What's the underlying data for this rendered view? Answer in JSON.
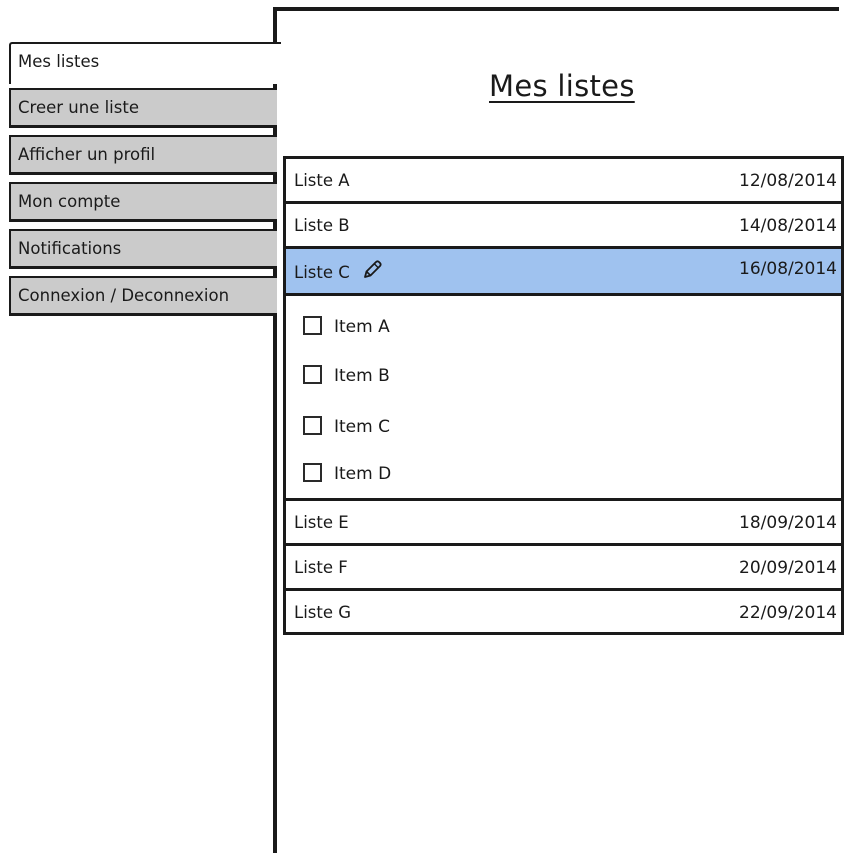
{
  "sidebar": {
    "tabs": [
      {
        "label": "Mes listes",
        "active": true
      },
      {
        "label": "Creer une liste",
        "active": false
      },
      {
        "label": "Afficher un profil",
        "active": false
      },
      {
        "label": "Mon compte",
        "active": false
      },
      {
        "label": "Notifications",
        "active": false
      },
      {
        "label": "Connexion / Deconnexion",
        "active": false
      }
    ]
  },
  "main": {
    "title": "Mes listes",
    "lists": [
      {
        "name": "Liste A",
        "date": "12/08/2014"
      },
      {
        "name": "Liste B",
        "date": "14/08/2014"
      },
      {
        "name": "Liste C",
        "date": "16/08/2014",
        "selected": true,
        "edit_icon": "pencil-icon"
      },
      {
        "name": "Liste E",
        "date": "18/09/2014"
      },
      {
        "name": "Liste F",
        "date": "20/09/2014"
      },
      {
        "name": "Liste G",
        "date": "22/09/2014"
      }
    ],
    "expanded_items": [
      {
        "label": "Item A",
        "checked": false
      },
      {
        "label": "Item B",
        "checked": false
      },
      {
        "label": "Item C",
        "checked": false
      },
      {
        "label": "Item D",
        "checked": false
      }
    ]
  },
  "colors": {
    "selected_row": "#9fc2ef",
    "inactive_tab": "#cbcbcb",
    "border": "#1a1a1a"
  }
}
